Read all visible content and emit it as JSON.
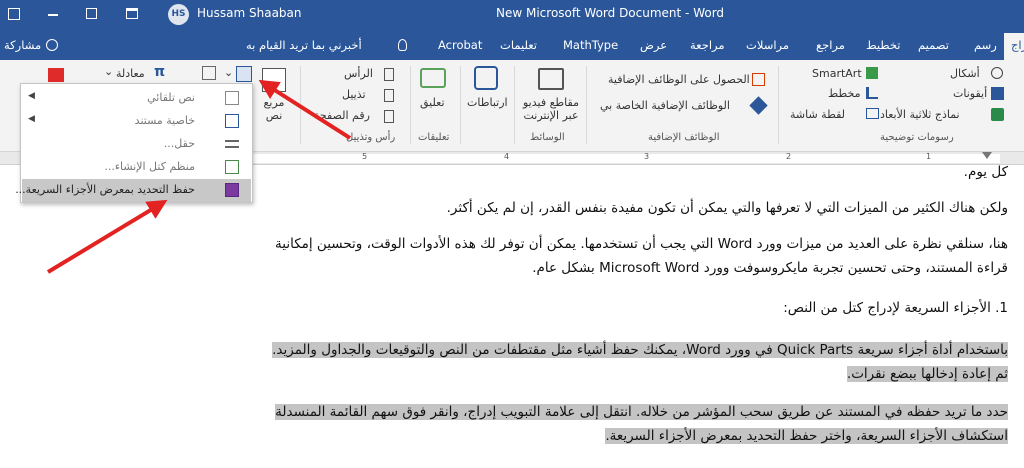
{
  "titlebar": {
    "user_name": "Hussam Shaaban",
    "avatar_initials": "HS",
    "document_title": "New Microsoft Word Document  -  Word"
  },
  "tabs": {
    "share": "مشاركة",
    "tell_me": "أخبرني بما تريد القيام به",
    "acrobat": "Acrobat",
    "items": [
      "تعليمات",
      "MathType",
      "عرض",
      "مراجعة",
      "مراسلات",
      "مراجع",
      "تخطيط",
      "تصميم",
      "رسم",
      "إدراج"
    ]
  },
  "ribbon": {
    "illustrations": {
      "shapes": "أشكال",
      "icons": "أيقونات",
      "models_3d": "نماذج ثلاثية الأبعاد",
      "smartart": "SmartArt",
      "chart": "مخطط",
      "screenshot": "لقطة شاشة",
      "group_label": "رسومات توضيحية"
    },
    "addins": {
      "get_addins": "الحصول على الوظائف الإضافية",
      "my_addins": "الوظائف الإضافية الخاصة بي",
      "group_label": "الوظائف الإضافية"
    },
    "media": {
      "online_video": "مقاطع فيديو عبر الإنترنت",
      "group_label": "الوسائط"
    },
    "links": {
      "links": "ارتباطات"
    },
    "comments": {
      "comment": "تعليق",
      "group_label": "تعليقات"
    },
    "header_footer": {
      "header": "الرأس",
      "footer": "تذييل",
      "page_number": "رقم الصفحة",
      "group_label": "رأس وتذييل"
    },
    "text": {
      "textbox": "مربع نص"
    },
    "symbols": {
      "equation": "معادلة"
    }
  },
  "ruler": {
    "numbers": [
      "1",
      "2",
      "3",
      "4",
      "5"
    ]
  },
  "menu": {
    "items": [
      {
        "label": "نص تلقائي",
        "has_submenu": true,
        "selected": false
      },
      {
        "label": "خاصية مستند",
        "has_submenu": true,
        "selected": false
      },
      {
        "label": "حقل...",
        "has_submenu": false,
        "selected": false
      },
      {
        "label": "منظم كتل الإنشاء...",
        "has_submenu": false,
        "selected": false
      },
      {
        "label": "حفظ التحديد بمعرض الأجزاء السريعة...",
        "has_submenu": false,
        "selected": true
      }
    ]
  },
  "document": {
    "line1": "كل يوم.",
    "line2": "ولكن هناك الكثير من الميزات التي لا تعرفها والتي يمكن أن تكون مفيدة بنفس القدر، إن لم يكن أكثر.",
    "line3": "هنا، سنلقي نظرة على العديد من ميزات وورد Word التي يجب أن تستخدمها. يمكن أن توفر لك هذه الأدوات الوقت، وتحسين إمكانية",
    "line4": "قراءة المستند، وحتى تحسين تجربة مايكروسوفت وورد Microsoft Word بشكل عام.",
    "heading": "1.  الأجزاء السريعة لإدراج كتل من النص:",
    "para1_a": "باستخدام أداة أجزاء سريعة Quick Parts في وورد Word، يمكنك حفظ أشياء مثل مقتطفات من النص والتوقيعات والجداول والمزيد.",
    "para1_b": "ثم إعادة إدخالها ببضع نقرات.",
    "para2_a": "حدد ما تريد حفظه في المستند عن طريق سحب المؤشر من خلاله. انتقل إلى علامة التبويب إدراج، وانقر فوق سهم القائمة المنسدلة",
    "para2_b": "استكشاف الأجزاء السريعة، واختر حفظ التحديد بمعرض الأجزاء السريعة."
  },
  "colors": {
    "word_blue": "#2b579a",
    "arrow_red": "#e32222",
    "highlight": "#c4c4c4"
  }
}
